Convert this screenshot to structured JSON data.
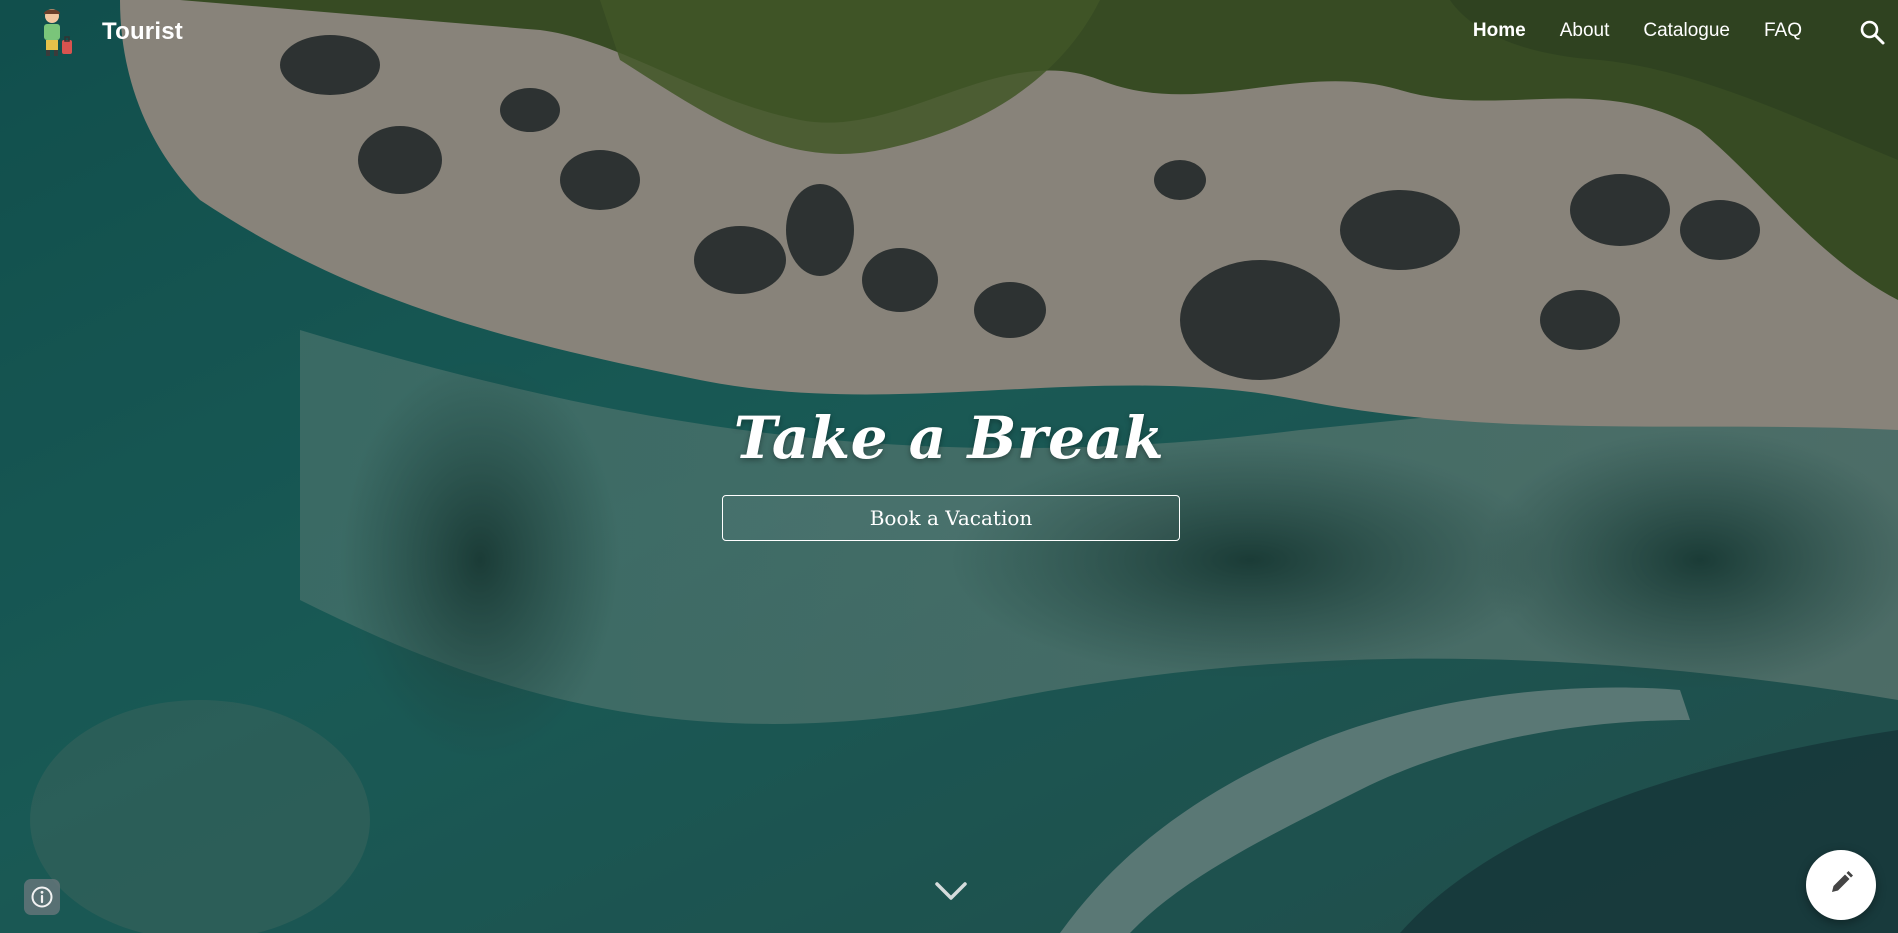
{
  "header": {
    "site_title": "Tourist",
    "logo_icon": "tourist-with-suitcase-icon",
    "nav": [
      {
        "label": "Home",
        "active": true
      },
      {
        "label": "About",
        "active": false
      },
      {
        "label": "Catalogue",
        "active": false
      },
      {
        "label": "FAQ",
        "active": false
      }
    ],
    "search_icon": "search-icon"
  },
  "hero": {
    "title": "Take a Break",
    "cta_label": "Book a Vacation",
    "scroll_icon": "chevron-down-icon"
  },
  "footer_controls": {
    "info_icon": "info-icon",
    "edit_icon": "pencil-icon"
  },
  "colors": {
    "text": "#ffffff",
    "sea": "#1d6f6a",
    "sand": "#cdbfae",
    "foliage": "#4f6a2a",
    "fab": "#ffffff"
  }
}
